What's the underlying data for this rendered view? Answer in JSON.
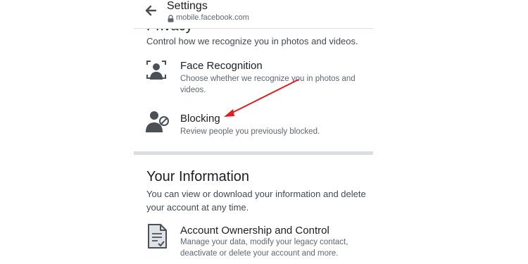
{
  "header": {
    "title": "Settings",
    "url": "mobile.facebook.com"
  },
  "privacy": {
    "title": "Privacy",
    "description": "Control how we recognize you in photos and videos."
  },
  "items": [
    {
      "title": "Face Recognition",
      "description": "Choose whether we recognize you in photos and videos."
    },
    {
      "title": "Blocking",
      "description": "Review people you previously blocked."
    }
  ],
  "your_information": {
    "title": "Your Information",
    "description": "You can view or download your information and delete your account at any time.",
    "items": [
      {
        "title": "Account Ownership and Control",
        "description": "Manage your data, modify your legacy contact, deactivate or delete your account and more."
      }
    ]
  },
  "colors": {
    "annotation_arrow": "#e02020",
    "icon_fill": "#4b4f56",
    "divider": "#dadde1"
  },
  "icons": [
    "back-arrow-icon",
    "lock-icon",
    "face-recognition-icon",
    "blocking-icon",
    "document-icon"
  ]
}
